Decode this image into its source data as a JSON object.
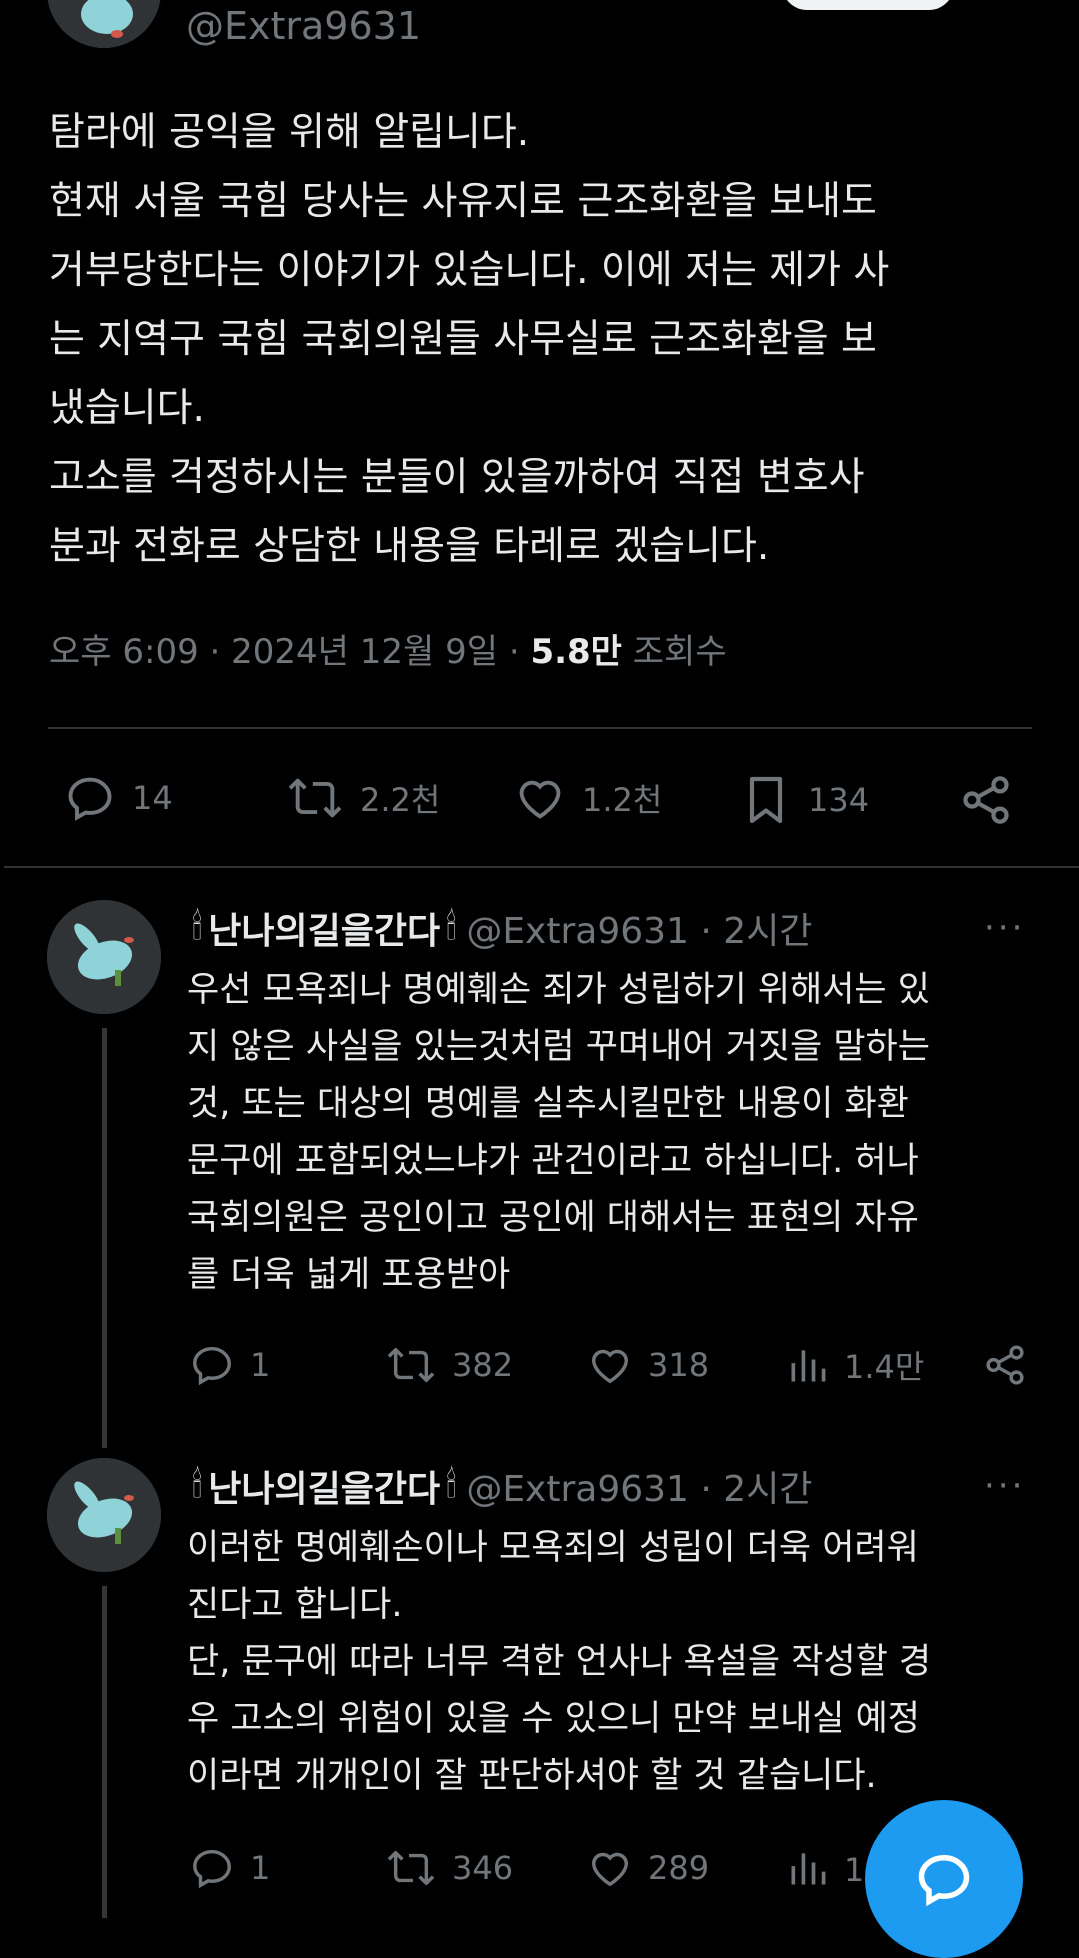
{
  "tweet": {
    "handle": "@Extra9631",
    "text": "탐라에 공익을 위해 알립니다.\n현재 서울 국힘 당사는 사유지로 근조화환을 보내도\n거부당한다는 이야기가 있습니다. 이에 저는 제가 사\n는 지역구 국힘 국회의원들 사무실로 근조화환을 보\n냈습니다.\n고소를 걱정하시는 분들이 있을까하여 직접 변호사\n분과 전화로 상담한 내용을 타레로 겠습니다.",
    "time": "오후 6:09 · 2024년 12월 9일 · ",
    "views": "5.8만",
    "views_label": " 조회수",
    "actions": {
      "replies": "14",
      "retweets": "2.2천",
      "likes": "1.2천",
      "bookmarks": "134"
    }
  },
  "replies": [
    {
      "name_prefix": "🕯",
      "name": "난나의길을간다",
      "name_suffix": "🕯",
      "handle": "@Extra9631 · 2시간",
      "more": "···",
      "text": "우선 모욕죄나 명예훼손 죄가 성립하기 위해서는 있\n지 않은 사실을 있는것처럼 꾸며내어 거짓을 말하는\n것, 또는 대상의 명예를 실추시킬만한 내용이 화환\n문구에 포함되었느냐가 관건이라고 하십니다. 허나\n국회의원은 공인이고 공인에 대해서는 표현의 자유\n를 더욱 넓게 포용받아",
      "actions": {
        "replies": "1",
        "retweets": "382",
        "likes": "318",
        "views": "1.4만"
      }
    },
    {
      "name_prefix": "🕯",
      "name": "난나의길을간다",
      "name_suffix": "🕯",
      "handle": "@Extra9631 · 2시간",
      "more": "···",
      "text": "이러한 명예훼손이나 모욕죄의 성립이 더욱 어려워\n진다고 합니다.\n단, 문구에 따라 너무 격한 언사나 욕설을 작성할 경\n우 고소의 위험이 있을 수 있으니 만약 보내실 예정\n이라면 개개인이 잘 판단하셔야 할 것 같습니다.",
      "actions": {
        "replies": "1",
        "retweets": "346",
        "likes": "289",
        "views": "1.4만"
      }
    }
  ],
  "icons": {
    "reply": "reply-icon",
    "retweet": "retweet-icon",
    "like": "heart-icon",
    "bookmark": "bookmark-icon",
    "share": "share-icon",
    "views": "views-icon",
    "fab": "compose-icon"
  },
  "colors": {
    "background": "#000000",
    "text": "#e7e9ea",
    "muted": "#71767b",
    "accent": "#1d9bf0"
  }
}
